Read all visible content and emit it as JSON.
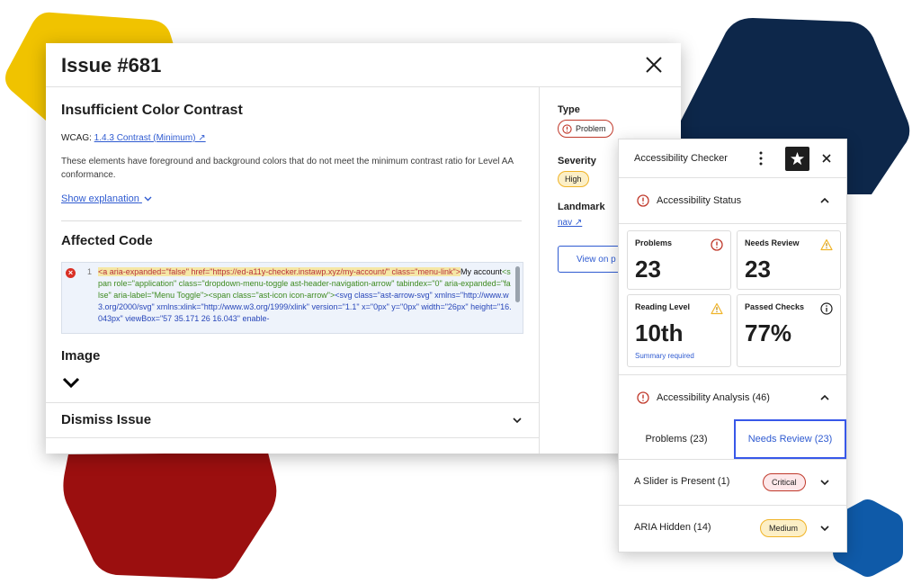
{
  "colors": {
    "yellow_blob": "#f0c300",
    "navy_blob": "#0d274a",
    "red_blob": "#9b0f0f",
    "blue_blob": "#0f5aa8",
    "link": "#2f5bd1",
    "problem": "#c0392b",
    "warning": "#f0b429"
  },
  "issue_modal": {
    "title": "Issue #681",
    "issue_name": "Insufficient Color Contrast",
    "wcag_label": "WCAG:",
    "wcag_link": "1.4.3 Contrast (Minimum) ↗",
    "description": "These elements have foreground and background colors that do not meet the minimum contrast ratio for Level AA conformance.",
    "show_explanation": "Show explanation",
    "affected_code_title": "Affected Code",
    "code_line_number": "1",
    "code": {
      "s1": "<a aria-expanded=\"false\" href=\"https://ed-a11y-checker.instawp.xyz/my-account/\" class=\"menu-link\">",
      "s2": "My account",
      "s3": "<span role=\"application\" class=\"dropdown-menu-toggle ast-header-navigation-arrow\" tabindex=\"0\" aria-expanded=\"false\" aria-label=\"Menu Toggle\">",
      "s4": "<span class=\"ast-icon icon-arrow\">",
      "s5": "<svg class=\"ast-arrow-svg\" xmlns=\"http://www.w3.org/2000/svg\" xmlns:xlink=\"http://www.w3.org/1999/xlink\" version=\"1.1\" x=\"0px\" y=\"0px\" width=\"26px\" height=\"16.043px\" viewBox=\"57 35.171 26 16.043\" enable-"
    },
    "image_title": "Image",
    "dismiss_title": "Dismiss Issue",
    "sidebar": {
      "type_label": "Type",
      "type_value": "Problem",
      "severity_label": "Severity",
      "severity_value": "High",
      "landmark_label": "Landmark",
      "landmark_value": "nav ↗",
      "view_button": "View on p"
    }
  },
  "checker_panel": {
    "title": "Accessibility Checker",
    "status_section": "Accessibility Status",
    "cards": [
      {
        "label": "Problems",
        "value": "23",
        "icon": "error-icon"
      },
      {
        "label": "Needs Review",
        "value": "23",
        "icon": "warning-icon"
      },
      {
        "label": "Reading Level",
        "value": "10th",
        "sub": "Summary required",
        "icon": "warning-icon"
      },
      {
        "label": "Passed Checks",
        "value": "77%",
        "icon": "info-icon"
      }
    ],
    "analysis_section": "Accessibility Analysis (46)",
    "tabs": [
      {
        "label": "Problems  (23)",
        "active": false
      },
      {
        "label": "Needs Review  (23)",
        "active": true
      }
    ],
    "issues": [
      {
        "label": "A Slider is Present (1)",
        "badge": "Critical"
      },
      {
        "label": "ARIA Hidden (14)",
        "badge": "Medium"
      }
    ]
  }
}
